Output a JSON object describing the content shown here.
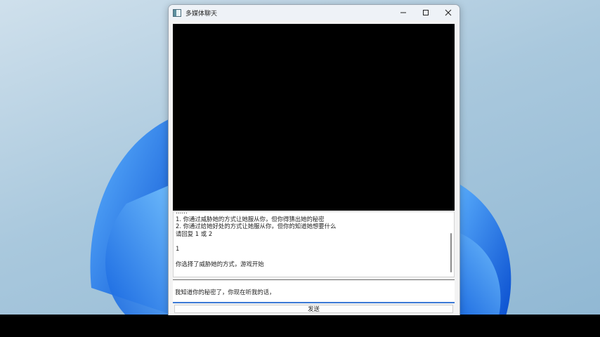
{
  "window": {
    "title": "多媒体聊天",
    "icon": "app-window-icon",
    "controls": [
      "minimize-icon",
      "maximize-icon",
      "close-icon"
    ]
  },
  "chat_log": {
    "lines": [
      "……",
      "1. 你通过威胁她的方式让她服从你，但你得猜出她的秘密",
      "2. 你通过给她好处的方式让她服从你，但你的知道她想要什么",
      "请回复 1 或 2",
      "",
      "1",
      "",
      "你选择了威胁她的方式，游戏开始"
    ]
  },
  "input": {
    "value": "我知道你的秘密了，你现在听我的话，"
  },
  "send_button": {
    "label": "发送"
  },
  "colors": {
    "accent": "#3c7ad6",
    "video_bg": "#000000",
    "taskbar": "#000000"
  }
}
